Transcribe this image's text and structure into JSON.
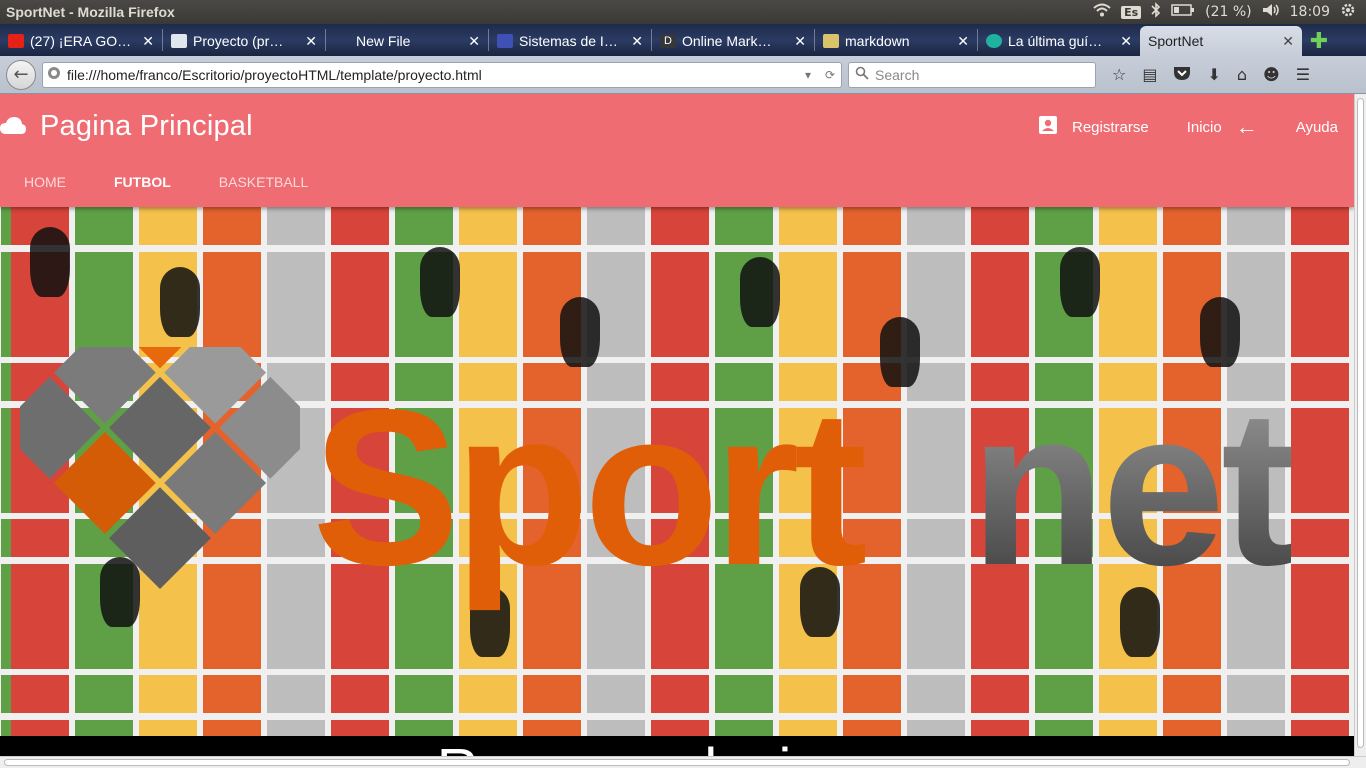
{
  "os": {
    "window_title": "SportNet - Mozilla Firefox",
    "keyboard_layout": "Es",
    "battery": "(21 %)",
    "clock": "18:09"
  },
  "tabs": [
    {
      "label": "(27) ¡ERA GO…",
      "icon": "youtube-icon",
      "color": "#e62117"
    },
    {
      "label": "Proyecto (pr…",
      "icon": "trello-icon",
      "color": "#dfe6ee"
    },
    {
      "label": "New File",
      "icon": "",
      "color": ""
    },
    {
      "label": "Sistemas de I…",
      "icon": "moodle-icon",
      "color": "#3f51b5"
    },
    {
      "label": "Online Mark…",
      "icon": "dillinger-icon",
      "color": "#35373a"
    },
    {
      "label": "markdown",
      "icon": "markdown-icon",
      "color": "#d9c36b"
    },
    {
      "label": "La última guí…",
      "icon": "globe-icon",
      "color": "#1fb39f"
    },
    {
      "label": "SportNet",
      "icon": "",
      "color": "",
      "active": true
    }
  ],
  "navbar": {
    "url": "file:///home/franco/Escritorio/proyectoHTML/template/proyecto.html",
    "search_placeholder": "Search"
  },
  "app": {
    "title": "Pagina Principal",
    "actions": {
      "register": "Registrarse",
      "home": "Inicio",
      "help": "Ayuda"
    },
    "tabs": [
      "HOME",
      "FUTBOL",
      "BASKETBALL"
    ],
    "selected_tab": "FUTBOL",
    "accent": "#ef6c73"
  },
  "hero": {
    "brand_part1": "Sport",
    "brand_part2": "net",
    "brand_color_orange": "#e05e08",
    "recommendations_heading": "Recomendaciones"
  }
}
